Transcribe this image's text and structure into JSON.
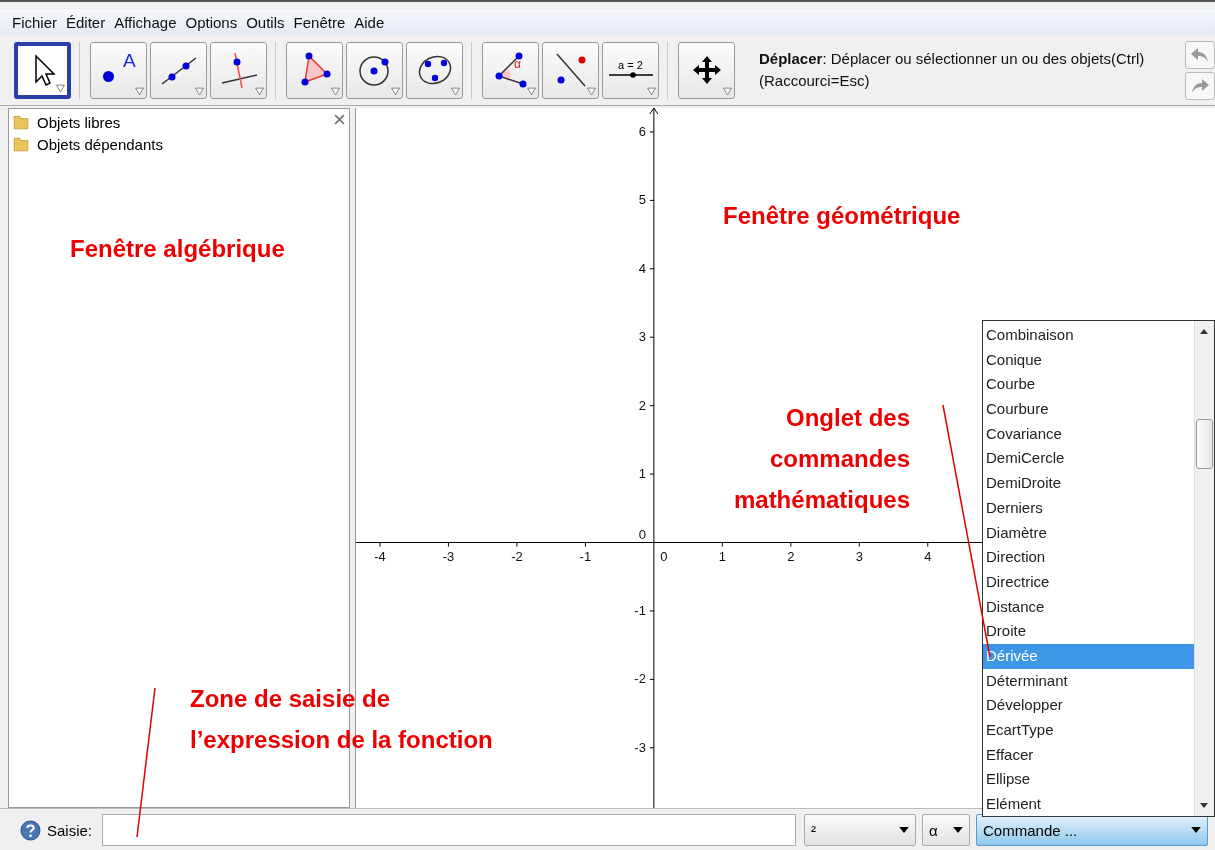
{
  "menu": [
    "Fichier",
    "Éditer",
    "Affichage",
    "Options",
    "Outils",
    "Fenêtre",
    "Aide"
  ],
  "toolbar": {
    "groups": [
      [
        {
          "kind": "pointer",
          "selected": true
        }
      ],
      [
        {
          "kind": "point",
          "selected": false,
          "text": "A"
        },
        {
          "kind": "line",
          "selected": false
        },
        {
          "kind": "perpendicular",
          "selected": false
        }
      ],
      [
        {
          "kind": "polygon",
          "selected": false
        },
        {
          "kind": "circle",
          "selected": false
        },
        {
          "kind": "conic",
          "selected": false
        }
      ],
      [
        {
          "kind": "angle",
          "selected": false,
          "text": "α"
        },
        {
          "kind": "reflect",
          "selected": false
        },
        {
          "kind": "slider",
          "selected": false,
          "text": "a = 2"
        }
      ],
      [
        {
          "kind": "move-view",
          "selected": false
        }
      ]
    ],
    "help_title": "Déplacer",
    "help_text": ": Déplacer ou sélectionner un ou des objets(Ctrl)",
    "help_shortcut": "(Raccourci=Esc)"
  },
  "algebra": {
    "folders": [
      "Objets libres",
      "Objets dépendants"
    ]
  },
  "graphics": {
    "origin_labels": [
      "0",
      "0"
    ],
    "chart_data": {
      "type": "line",
      "xlim": [
        -4.35,
        8.18
      ],
      "ylim": [
        -3.88,
        6.35
      ],
      "xticks": [
        -4,
        -3,
        -2,
        -1,
        1,
        2,
        3,
        4
      ],
      "yticks": [
        -3,
        -2,
        -1,
        1,
        2,
        3,
        4,
        5,
        6
      ]
    }
  },
  "command_list": {
    "items": [
      {
        "label": "Combinaison",
        "selected": false
      },
      {
        "label": "Conique",
        "selected": false
      },
      {
        "label": "Courbe",
        "selected": false
      },
      {
        "label": "Courbure",
        "selected": false
      },
      {
        "label": "Covariance",
        "selected": false
      },
      {
        "label": "DemiCercle",
        "selected": false
      },
      {
        "label": "DemiDroite",
        "selected": false
      },
      {
        "label": "Derniers",
        "selected": false
      },
      {
        "label": "Diamètre",
        "selected": false
      },
      {
        "label": "Direction",
        "selected": false
      },
      {
        "label": "Directrice",
        "selected": false
      },
      {
        "label": "Distance",
        "selected": false
      },
      {
        "label": "Droite",
        "selected": false
      },
      {
        "label": "Dérivée",
        "selected": true
      },
      {
        "label": "Déterminant",
        "selected": false
      },
      {
        "label": "Développer",
        "selected": false
      },
      {
        "label": "EcartType",
        "selected": false
      },
      {
        "label": "Effacer",
        "selected": false
      },
      {
        "label": "Ellipse",
        "selected": false
      },
      {
        "label": "Elément",
        "selected": false
      }
    ]
  },
  "input_bar": {
    "label": "Saisie:",
    "symbols": "²",
    "greek": "α",
    "command": "Commande ..."
  },
  "annotations": [
    {
      "lines": [
        "Fenêtre algébrique"
      ]
    },
    {
      "lines": [
        "Fenêtre géométrique"
      ]
    },
    {
      "lines": [
        "Onglet des",
        "commandes",
        "mathématiques"
      ]
    },
    {
      "lines": [
        "Zone de saisie de",
        "l’expression de la fonction"
      ]
    }
  ]
}
